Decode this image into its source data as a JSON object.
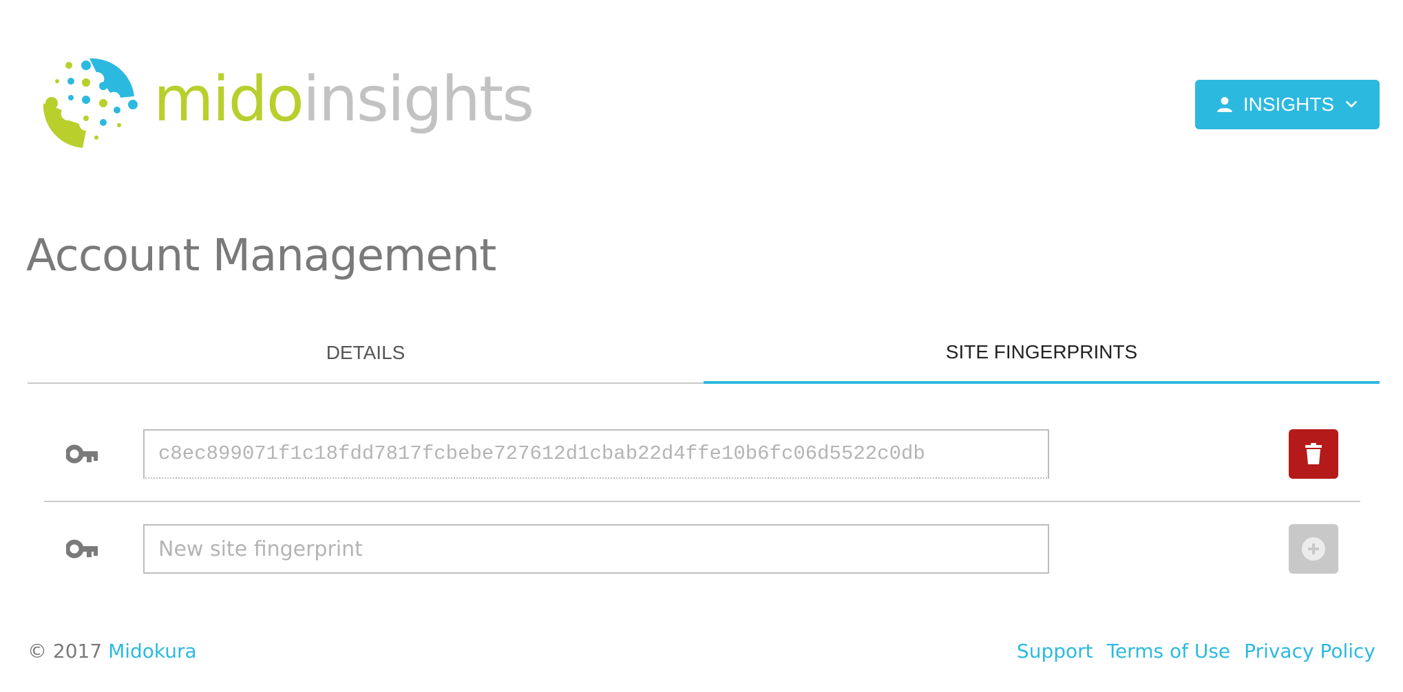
{
  "header": {
    "logo_part1": "mido",
    "logo_part2": "insights",
    "account_button_label": "INSIGHTS",
    "account_button_icons": [
      "person-icon",
      "chevron-down-icon"
    ]
  },
  "page": {
    "title": "Account Management"
  },
  "tabs": [
    {
      "label": "DETAILS",
      "active": false
    },
    {
      "label": "SITE FINGERPRINTS",
      "active": true
    }
  ],
  "fingerprints": {
    "items": [
      {
        "value": "c8ec899071f1c18fdd7817fcbebe727612d1cbab22d4ffe10b6fc06d5522c0db",
        "icon": "key-icon",
        "action_icon": "trash-icon"
      }
    ],
    "new_entry": {
      "placeholder": "New site fingerprint",
      "value": "",
      "icon": "key-icon",
      "action_icon": "plus-circle-icon"
    }
  },
  "footer": {
    "copyright": "© 2017",
    "company_link": "Midokura",
    "links": [
      "Support",
      "Terms of Use",
      "Privacy Policy"
    ]
  },
  "colors": {
    "accent": "#2cb9e0",
    "brand_green": "#b8cf2c",
    "danger": "#b51a1a",
    "disabled": "#c8c8c8"
  }
}
